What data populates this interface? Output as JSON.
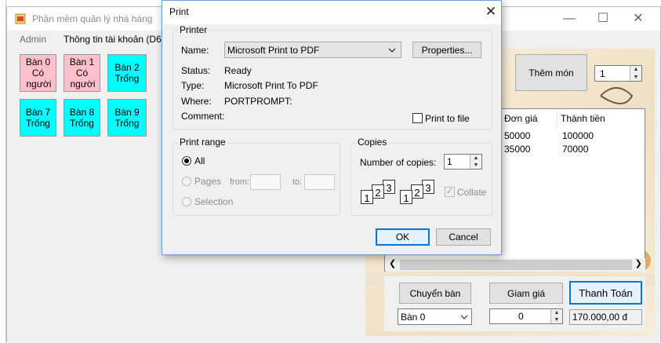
{
  "app": {
    "title": "Phần mềm quản lý nhà hàng",
    "menu": [
      "Admin",
      "Thông tin tài khoản (D6)"
    ],
    "tables": [
      {
        "name": "Bàn 0",
        "status": "Có người",
        "state": "busy"
      },
      {
        "name": "Bàn 1",
        "status": "Có người",
        "state": "busy"
      },
      {
        "name": "Bàn 2",
        "status": "Trống",
        "state": "free"
      },
      {
        "name": "Bàn 7",
        "status": "Trống",
        "state": "free"
      },
      {
        "name": "Bàn 8",
        "status": "Trống",
        "state": "free"
      },
      {
        "name": "Bàn 9",
        "status": "Trống",
        "state": "free"
      }
    ],
    "add_food_label": "Thêm món",
    "food_count": "1",
    "bill": {
      "columns": [
        "Đơn giá",
        "Thành tiền"
      ],
      "rows": [
        {
          "price": "50000",
          "total": "100000"
        },
        {
          "price": "35000",
          "total": "70000"
        }
      ]
    },
    "switch_table_label": "Chuyển bàn",
    "discount_label": "Giam giá",
    "checkout_label": "Thanh Toán",
    "switch_table_value": "Bàn 0",
    "discount_value": "0",
    "total_price": "170.000,00 đ"
  },
  "dialog": {
    "title": "Print",
    "printer": {
      "group_label": "Printer",
      "name_label": "Name:",
      "name_value": "Microsoft Print to PDF",
      "properties_label": "Properties...",
      "status_label": "Status:",
      "status_value": "Ready",
      "type_label": "Type:",
      "type_value": "Microsoft Print To PDF",
      "where_label": "Where:",
      "where_value": "PORTPROMPT:",
      "comment_label": "Comment:",
      "print_to_file_label": "Print to file"
    },
    "range": {
      "group_label": "Print range",
      "all_label": "All",
      "pages_label": "Pages",
      "from_label": "from:",
      "to_label": "to:",
      "selection_label": "Selection"
    },
    "copies": {
      "group_label": "Copies",
      "number_label": "Number of copies:",
      "number_value": "1",
      "collate_label": "Collate",
      "page_digits": [
        "1",
        "2",
        "3"
      ]
    },
    "ok_label": "OK",
    "cancel_label": "Cancel"
  }
}
